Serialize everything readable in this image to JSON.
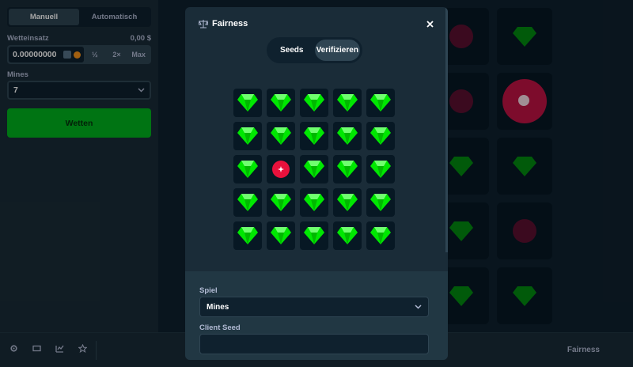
{
  "sidebar": {
    "tabs": [
      {
        "label": "Manuell",
        "active": true
      },
      {
        "label": "Automatisch",
        "active": false
      }
    ],
    "bet_label": "Wetteinsatz",
    "bet_value_display": "0,00 $",
    "bet_amount": "0.00000000",
    "half_label": "½",
    "double_label": "2×",
    "max_label": "Max",
    "mines_label": "Mines",
    "mines_value": "7",
    "bet_button": "Wetten"
  },
  "footer": {
    "right_label": "Fairness",
    "icons": [
      "gear-icon",
      "window-icon",
      "chart-icon",
      "star-icon"
    ]
  },
  "modal": {
    "title": "Fairness",
    "tabs": [
      {
        "label": "Seeds",
        "active": false
      },
      {
        "label": "Verifizieren",
        "active": true
      }
    ],
    "game_label": "Spiel",
    "game_value": "Mines",
    "client_seed_label": "Client Seed",
    "client_seed_value": ""
  },
  "colors": {
    "gem": "#00e701",
    "mine": "#e9113c",
    "accent_button": "#00b31e",
    "panel": "#1a2c38",
    "background": "#0f212e"
  },
  "grid": {
    "rows": 5,
    "cols": 5,
    "cells": [
      "gem",
      "gem",
      "gem",
      "gem",
      "gem",
      "gem",
      "gem",
      "gem",
      "gem",
      "gem",
      "gem",
      "mine",
      "gem",
      "gem",
      "gem",
      "gem",
      "gem",
      "gem",
      "gem",
      "gem",
      "gem",
      "gem",
      "gem",
      "gem",
      "gem"
    ]
  },
  "background_board": {
    "cells": [
      "mine",
      "gem",
      "mine",
      "mine-revealed",
      "gem",
      "gem",
      "gem",
      "mine",
      "gem",
      "gem"
    ]
  }
}
